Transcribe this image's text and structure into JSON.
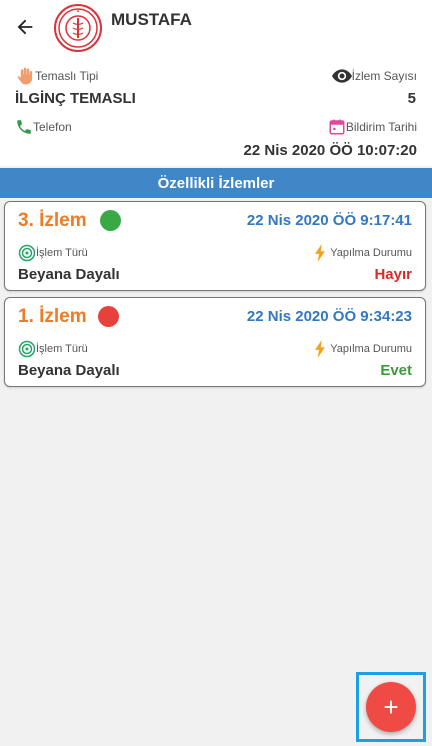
{
  "header": {
    "title": "MUSTAFA"
  },
  "info": {
    "contact_type_label": "Temaslı Tipi",
    "contact_type_value": "İLGİNÇ TEMASLI",
    "monitor_count_label": "İzlem Sayısı",
    "monitor_count_value": "5",
    "phone_label": "Telefon",
    "report_date_label": "Bildirim Tarihi",
    "report_date_value": "22 Nis 2020 ÖÖ 10:07:20"
  },
  "section": {
    "title": "Özellikli İzlemler"
  },
  "monitors": [
    {
      "title": "3. İzlem",
      "status_color": "#3aa845",
      "date": "22 Nis 2020 ÖÖ 9:17:41",
      "type_label": "İşlem Türü",
      "type_value": "Beyana Dayalı",
      "done_label": "Yapılma Durumu",
      "done_value": "Hayır",
      "done_color": "#d52b2b"
    },
    {
      "title": "1. İzlem",
      "status_color": "#e8403a",
      "date": "22 Nis 2020 ÖÖ 9:34:23",
      "type_label": "İşlem Türü",
      "type_value": "Beyana Dayalı",
      "done_label": "Yapılma Durumu",
      "done_value": "Evet",
      "done_color": "#3a9b3a"
    }
  ],
  "fab": {
    "icon": "+"
  },
  "colors": {
    "accent_blue": "#3f87c7",
    "title_orange": "#f07b24",
    "fab_red": "#ef4a43"
  }
}
